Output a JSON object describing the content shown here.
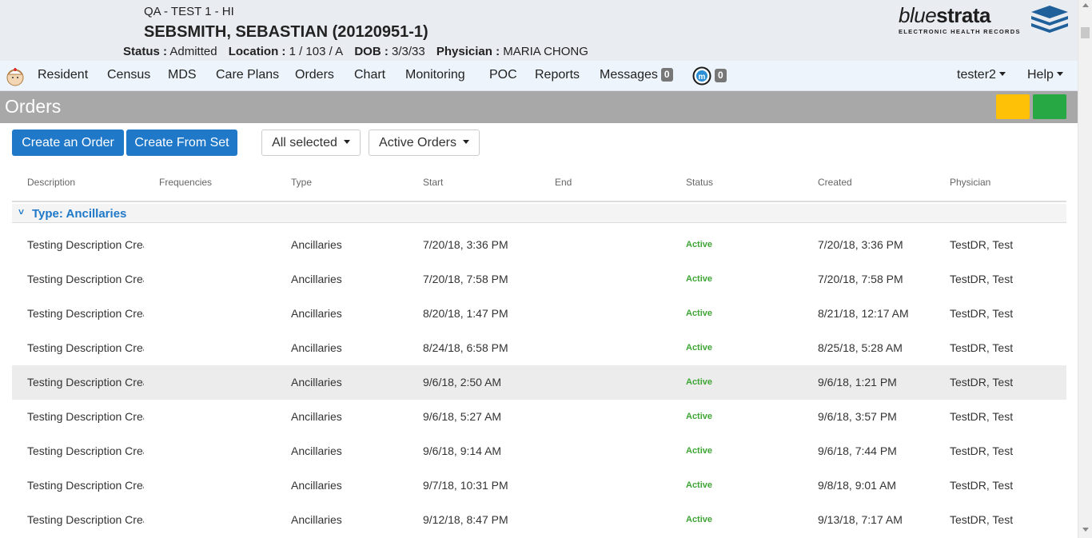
{
  "header": {
    "facility": "QA - TEST 1 - HI",
    "patient_name": "SEBSMITH, SEBASTIAN (20120951-1)",
    "status_label": "Status :",
    "status_value": "Admitted",
    "location_label": "Location :",
    "location_value": "1 / 103 / A",
    "dob_label": "DOB :",
    "dob_value": "3/3/33",
    "physician_label": "Physician :",
    "physician_value": "MARIA CHONG",
    "logo_thin": "blue",
    "logo_bold": "strata",
    "logo_sub": "ELECTRONIC HEALTH RECORDS"
  },
  "nav": {
    "items": [
      "Resident",
      "Census",
      "MDS",
      "Care Plans",
      "Orders",
      "Chart",
      "Monitoring",
      "POC",
      "Reports",
      "Messages"
    ],
    "messages_count": "0",
    "m_count": "0",
    "user": "tester2",
    "help": "Help"
  },
  "page": {
    "title": "Orders",
    "accent_yellow": "#ffc107",
    "accent_green": "#28a745"
  },
  "toolbar": {
    "create_order": "Create an Order",
    "create_from_set": "Create From Set",
    "filter_all": "All selected",
    "filter_active": "Active Orders"
  },
  "table": {
    "columns": [
      "Description",
      "Frequencies",
      "Type",
      "Start",
      "End",
      "Status",
      "Created",
      "Physician"
    ],
    "group_label": "Type: Ancillaries",
    "rows": [
      {
        "description": "Testing Description Crea",
        "type": "Ancillaries",
        "start": "7/20/18, 3:36 PM",
        "status": "Active",
        "created": "7/20/18, 3:36 PM",
        "physician": "TestDR, Test"
      },
      {
        "description": "Testing Description Crea",
        "type": "Ancillaries",
        "start": "7/20/18, 7:58 PM",
        "status": "Active",
        "created": "7/20/18, 7:58 PM",
        "physician": "TestDR, Test"
      },
      {
        "description": "Testing Description Crea",
        "type": "Ancillaries",
        "start": "8/20/18, 1:47 PM",
        "status": "Active",
        "created": "8/21/18, 12:17 AM",
        "physician": "TestDR, Test"
      },
      {
        "description": "Testing Description Crea",
        "type": "Ancillaries",
        "start": "8/24/18, 6:58 PM",
        "status": "Active",
        "created": "8/25/18, 5:28 AM",
        "physician": "TestDR, Test"
      },
      {
        "description": "Testing Description Crea",
        "type": "Ancillaries",
        "start": "9/6/18, 2:50 AM",
        "status": "Active",
        "created": "9/6/18, 1:21 PM",
        "physician": "TestDR, Test"
      },
      {
        "description": "Testing Description Crea",
        "type": "Ancillaries",
        "start": "9/6/18, 5:27 AM",
        "status": "Active",
        "created": "9/6/18, 3:57 PM",
        "physician": "TestDR, Test"
      },
      {
        "description": "Testing Description Crea",
        "type": "Ancillaries",
        "start": "9/6/18, 9:14 AM",
        "status": "Active",
        "created": "9/6/18, 7:44 PM",
        "physician": "TestDR, Test"
      },
      {
        "description": "Testing Description Crea",
        "type": "Ancillaries",
        "start": "9/7/18, 10:31 PM",
        "status": "Active",
        "created": "9/8/18, 9:01 AM",
        "physician": "TestDR, Test"
      },
      {
        "description": "Testing Description Crea",
        "type": "Ancillaries",
        "start": "9/12/18, 8:47 PM",
        "status": "Active",
        "created": "9/13/18, 7:17 AM",
        "physician": "TestDR, Test"
      }
    ]
  }
}
